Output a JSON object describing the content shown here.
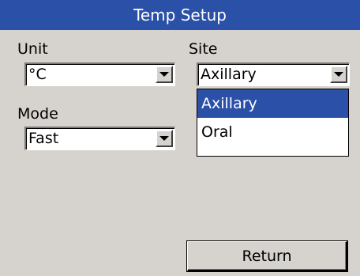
{
  "window": {
    "title": "Temp Setup"
  },
  "unit": {
    "label": "Unit",
    "value": "°C"
  },
  "site": {
    "label": "Site",
    "value": "Axillary",
    "options": [
      "Axillary",
      "Oral"
    ],
    "highlighted": "Axillary"
  },
  "mode": {
    "label": "Mode",
    "value": "Fast"
  },
  "actions": {
    "return_label": "Return"
  },
  "colors": {
    "title_bar": "#2b50a8",
    "background": "#d6d3ce",
    "selection": "#2b50a8"
  }
}
